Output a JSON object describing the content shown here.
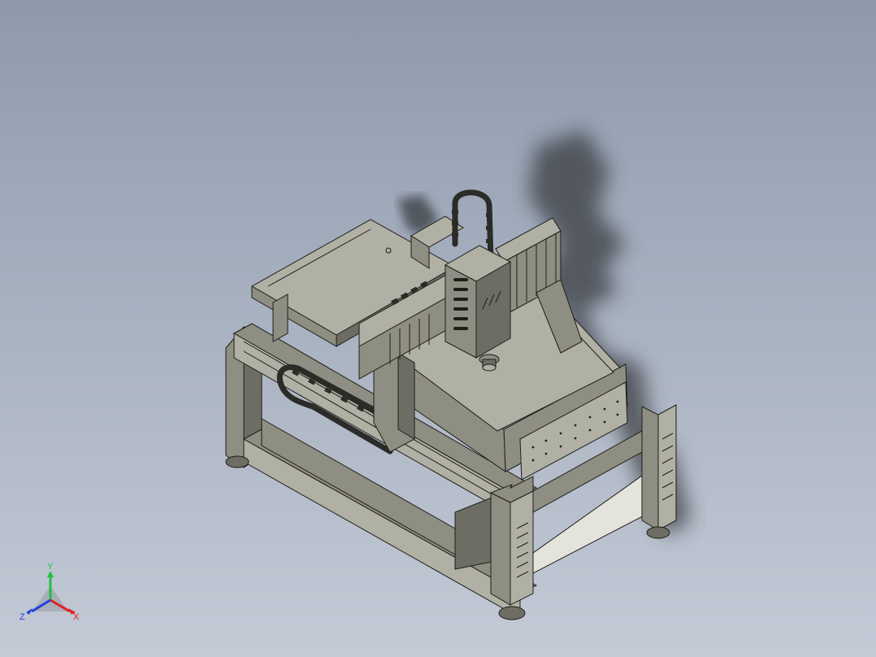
{
  "viewport": {
    "background_top": "#8e9aac",
    "background_bottom": "#c4cad6"
  },
  "model": {
    "body_color": "#8f8e82",
    "light_color": "#b1b0a4",
    "dark_color": "#6e6d63",
    "edge_color": "#1e1e1a",
    "shadow_color": "#3a3d42",
    "panel_white": "#e4e4dc"
  },
  "triad": {
    "x_label": "X",
    "y_label": "Y",
    "z_label": "Z",
    "x_color": "#e02020",
    "y_color": "#20c040",
    "z_color": "#2040e0"
  }
}
